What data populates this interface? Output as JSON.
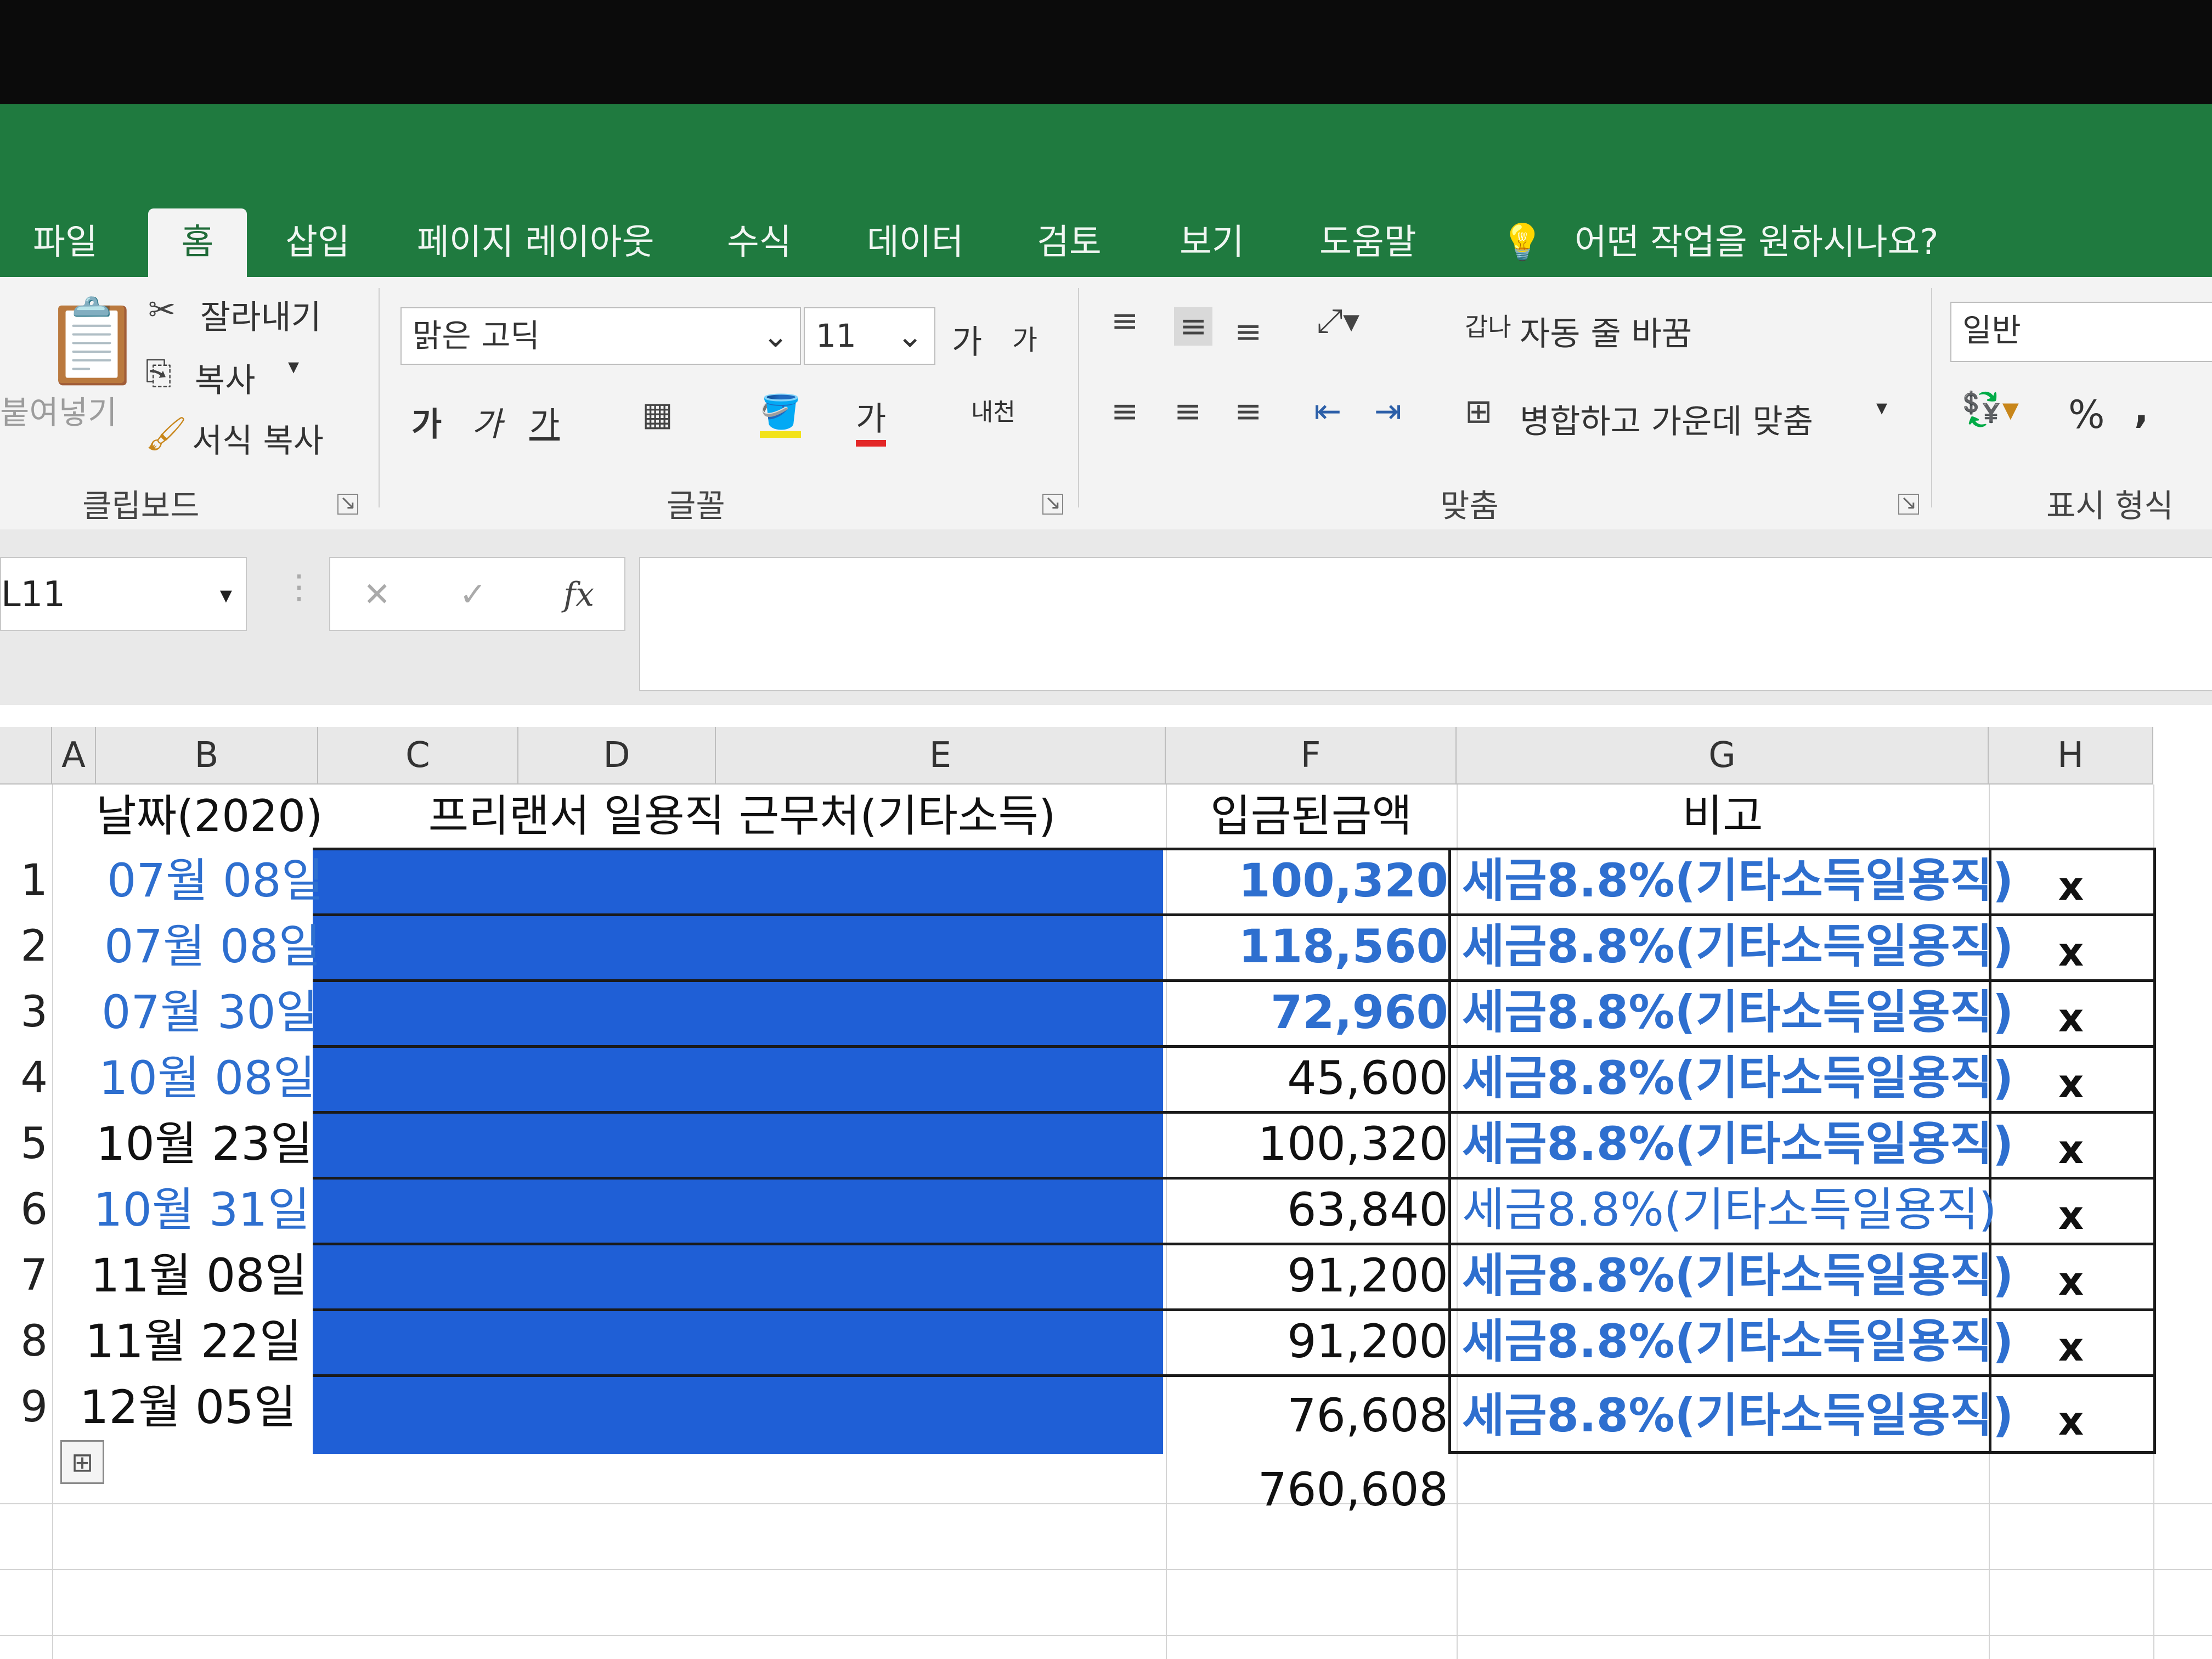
{
  "quick_access": {
    "save_icon": "save-icon",
    "undo_icon": "undo-icon",
    "redo_icon": "redo-icon",
    "customize_icon": "customize-icon"
  },
  "tabs": [
    "파일",
    "홈",
    "삽입",
    "페이지 레이아웃",
    "수식",
    "데이터",
    "검토",
    "보기",
    "도움말"
  ],
  "active_tab": "홈",
  "tell_me": "어떤 작업을 원하시나요?",
  "ribbon": {
    "clipboard": {
      "paste": "붙여넣기",
      "cut": "잘라내기",
      "copy": "복사",
      "format_painter": "서식 복사",
      "group": "클립보드"
    },
    "font": {
      "name": "맑은 고딕",
      "size": "11",
      "grow": "가",
      "shrink": "가",
      "bold": "가",
      "italic": "가",
      "underline": "가",
      "font_color": "가",
      "phonetic": "내천",
      "group": "글꼴"
    },
    "alignment": {
      "wrap_text": "자동 줄 바꿈",
      "merge_center": "병합하고 가운데 맞춤",
      "group": "맞춤",
      "wrap_icon_text": "갑나"
    },
    "number": {
      "format": "일반",
      "percent": "%",
      "comma": ",",
      "group": "표시 형식"
    }
  },
  "name_box": "L11",
  "formula_bar": {
    "cancel": "✕",
    "enter": "✓",
    "fx": "fx",
    "value": ""
  },
  "columns": [
    "A",
    "B",
    "C",
    "D",
    "E",
    "F",
    "G",
    "H"
  ],
  "header_row": {
    "date": "날짜(2020)",
    "workplace": "프리랜서 일용직 근무처(기타소득)",
    "amount": "입금된금액",
    "note": "비고"
  },
  "rows": [
    {
      "no": "1",
      "date": "07월 08일",
      "amount": "100,320",
      "note": "세금8.8%(기타소득일용직)",
      "mark": "x"
    },
    {
      "no": "2",
      "date": "07월 08일",
      "amount": "118,560",
      "note": "세금8.8%(기타소득일용직)",
      "mark": "x"
    },
    {
      "no": "3",
      "date": "07월 30일",
      "amount": "72,960",
      "note": "세금8.8%(기타소득일용직)",
      "mark": "x"
    },
    {
      "no": "4",
      "date": "10월 08일",
      "amount": "45,600",
      "note": "세금8.8%(기타소득일용직)",
      "mark": "x"
    },
    {
      "no": "5",
      "date": "10월 23일",
      "amount": "100,320",
      "note": "세금8.8%(기타소득일용직)",
      "mark": "x"
    },
    {
      "no": "6",
      "date": "10월 31일",
      "amount": "63,840",
      "note": "세금8.8%(기타소득일용직)",
      "mark": "x"
    },
    {
      "no": "7",
      "date": "11월 08일",
      "amount": "91,200",
      "note": "세금8.8%(기타소득일용직)",
      "mark": "x"
    },
    {
      "no": "8",
      "date": "11월 22일",
      "amount": "91,200",
      "note": "세금8.8%(기타소득일용직)",
      "mark": "x"
    },
    {
      "no": "9",
      "date": "12월 05일",
      "amount": "76,608",
      "note": "세금8.8%(기타소득일용직)",
      "mark": "x"
    }
  ],
  "total": "760,608",
  "colors": {
    "excel_green": "#1f7a3f",
    "note_blue": "#2e6fcf",
    "redaction_blue": "#1f5fd6"
  }
}
